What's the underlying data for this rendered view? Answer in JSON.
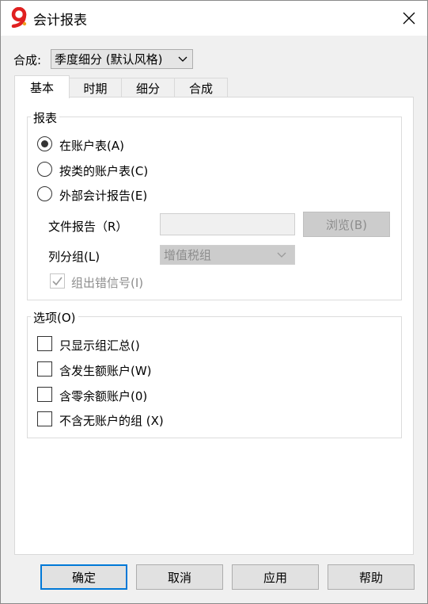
{
  "window": {
    "title": "会计报表",
    "close_label": "✕"
  },
  "header": {
    "combo_label": "合成:",
    "combo_value": "季度细分 (默认风格)"
  },
  "tabs": [
    {
      "label": "基本",
      "active": true
    },
    {
      "label": "时期",
      "active": false
    },
    {
      "label": "细分",
      "active": false
    },
    {
      "label": "合成",
      "active": false
    }
  ],
  "report_group": {
    "title": "报表",
    "options": [
      {
        "label": "在账户表(A)",
        "checked": true
      },
      {
        "label": "按类的账户表(C)",
        "checked": false
      },
      {
        "label": "外部会计报告(E)",
        "checked": false
      }
    ],
    "file_report_label": "文件报告（R）",
    "file_report_value": "",
    "browse_label": "浏览(B)",
    "column_group_label": "列分组(L)",
    "column_group_value": "增值税组",
    "group_error_label": "组出错信号(I)",
    "group_error_checked": true
  },
  "options_group": {
    "title": "选项(O)",
    "items": [
      {
        "label": "只显示组汇总()",
        "checked": false
      },
      {
        "label": "含发生额账户(W)",
        "checked": false
      },
      {
        "label": "含零余额账户(0)",
        "checked": false
      },
      {
        "label": "不含无账户的组 (X)",
        "checked": false
      }
    ]
  },
  "footer": {
    "ok_label": "确定",
    "cancel_label": "取消",
    "apply_label": "应用",
    "help_label": "帮助"
  },
  "colors": {
    "accent": "#0078d7",
    "app_icon": "#e02020"
  },
  "icons": {
    "app": "app-logo-icon",
    "close": "close-icon",
    "dropdown": "chevron-down-icon",
    "check": "checkmark-icon"
  }
}
